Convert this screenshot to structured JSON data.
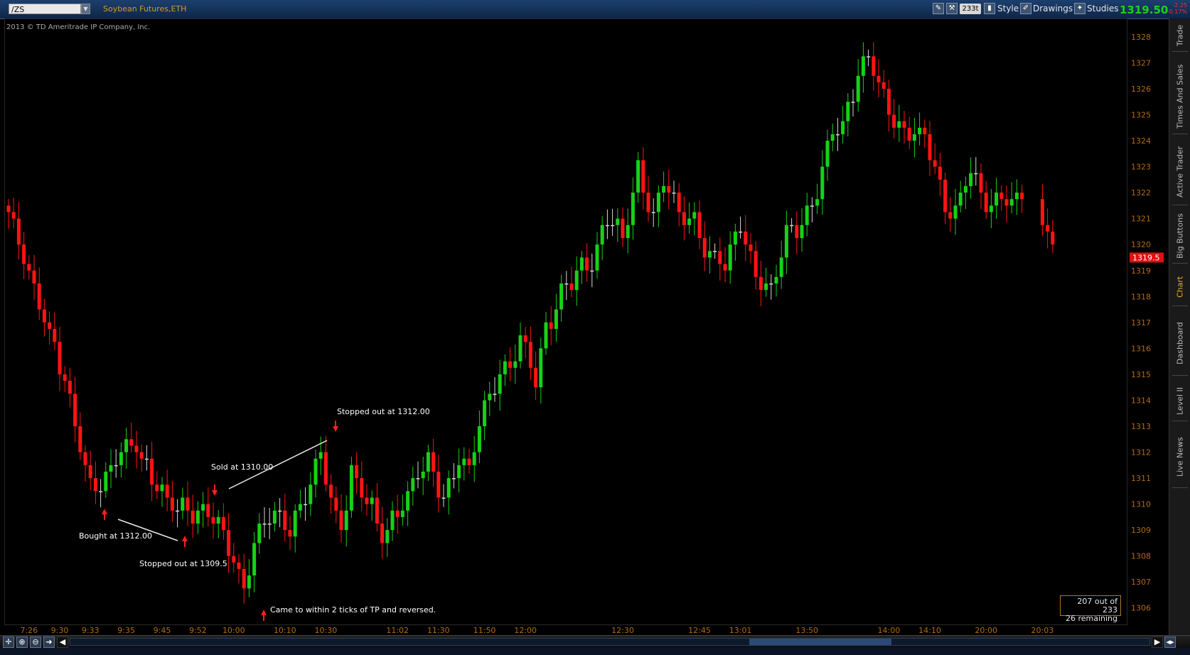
{
  "header": {
    "symbol": "/ZS",
    "title": "Soybean Futures,ETH",
    "ticks_badge": "233t",
    "style_label": "Style",
    "drawings_label": "Drawings",
    "studies_label": "Studies",
    "last_price": "1319.50",
    "change_abs": "-2.25",
    "change_pct": "-0.17%"
  },
  "copyright": "2013 © TD Ameritrade IP Company, Inc.",
  "current_price_label": "1319.5",
  "counter": {
    "line1": "207 out of 233",
    "line2": "26  remaining"
  },
  "side_tabs": [
    "Trade",
    "Times And Sales",
    "Active Trader",
    "Big Buttons",
    "Chart",
    "Dashboard",
    "Level II",
    "Live News"
  ],
  "colors": {
    "up": "#17d117",
    "down": "#ff1414",
    "neutral": "#d8d8d8",
    "axis_text": "#b26a14",
    "annotation": "#ffffff",
    "arrow": "#ff2020"
  },
  "chart_data": {
    "type": "candlestick",
    "ylim": [
      1305.5,
      1328.6
    ],
    "y_ticks": [
      1306,
      1307,
      1308,
      1309,
      1310,
      1311,
      1312,
      1313,
      1314,
      1315,
      1316,
      1317,
      1318,
      1319,
      1320,
      1321,
      1322,
      1323,
      1324,
      1325,
      1326,
      1327,
      1328
    ],
    "x_tick_labels": [
      {
        "i": 4,
        "label": "7:26"
      },
      {
        "i": 10,
        "label": "9:30"
      },
      {
        "i": 16,
        "label": "9:33"
      },
      {
        "i": 23,
        "label": "9:35"
      },
      {
        "i": 30,
        "label": "9:45"
      },
      {
        "i": 37,
        "label": "9:52"
      },
      {
        "i": 44,
        "label": "10:00"
      },
      {
        "i": 54,
        "label": "10:10"
      },
      {
        "i": 62,
        "label": "10:30"
      },
      {
        "i": 76,
        "label": "11:02"
      },
      {
        "i": 84,
        "label": "11:30"
      },
      {
        "i": 93,
        "label": "11:50"
      },
      {
        "i": 101,
        "label": "12:00"
      },
      {
        "i": 120,
        "label": "12:30"
      },
      {
        "i": 135,
        "label": "12:45"
      },
      {
        "i": 143,
        "label": "13:01"
      },
      {
        "i": 156,
        "label": "13:50"
      },
      {
        "i": 172,
        "label": "14:00"
      },
      {
        "i": 180,
        "label": "14:10"
      },
      {
        "i": 191,
        "label": "20:00"
      },
      {
        "i": 199,
        "label": "20:03"
      }
    ],
    "anchors": [
      [
        0,
        1321
      ],
      [
        6,
        1318
      ],
      [
        11,
        1314.5
      ],
      [
        16,
        1311
      ],
      [
        19,
        1310.8
      ],
      [
        22,
        1312
      ],
      [
        25,
        1312.5
      ],
      [
        28,
        1311
      ],
      [
        31,
        1309.8
      ],
      [
        35,
        1310
      ],
      [
        38,
        1309.8
      ],
      [
        41,
        1309
      ],
      [
        44,
        1308
      ],
      [
        46,
        1307
      ],
      [
        48,
        1308.5
      ],
      [
        51,
        1309.3
      ],
      [
        55,
        1309.3
      ],
      [
        58,
        1310.3
      ],
      [
        61,
        1311.8
      ],
      [
        63,
        1310
      ],
      [
        65,
        1309.3
      ],
      [
        67,
        1311.3
      ],
      [
        70,
        1310
      ],
      [
        73,
        1308.7
      ],
      [
        76,
        1310
      ],
      [
        79,
        1310.6
      ],
      [
        82,
        1311.6
      ],
      [
        85,
        1310.4
      ],
      [
        88,
        1311.8
      ],
      [
        90,
        1311
      ],
      [
        92,
        1313
      ],
      [
        94,
        1314.3
      ],
      [
        96,
        1315.2
      ],
      [
        98,
        1315.4
      ],
      [
        100,
        1316.2
      ],
      [
        103,
        1314.8
      ],
      [
        105,
        1317
      ],
      [
        108,
        1318.2
      ],
      [
        111,
        1318.6
      ],
      [
        114,
        1319.5
      ],
      [
        117,
        1321.3
      ],
      [
        120,
        1320
      ],
      [
        123,
        1322.8
      ],
      [
        126,
        1321.3
      ],
      [
        128,
        1322.5
      ],
      [
        131,
        1321
      ],
      [
        134,
        1321
      ],
      [
        137,
        1319.7
      ],
      [
        140,
        1319
      ],
      [
        143,
        1320.8
      ],
      [
        146,
        1319
      ],
      [
        149,
        1318
      ],
      [
        152,
        1320.3
      ],
      [
        155,
        1321
      ],
      [
        158,
        1322
      ],
      [
        161,
        1324.2
      ],
      [
        163,
        1324.6
      ],
      [
        166,
        1326.8
      ],
      [
        168,
        1327.2
      ],
      [
        170,
        1326
      ],
      [
        172,
        1325
      ],
      [
        175,
        1324.5
      ],
      [
        177,
        1324.6
      ],
      [
        179,
        1324
      ],
      [
        181,
        1322.8
      ],
      [
        183,
        1321.2
      ],
      [
        186,
        1322
      ],
      [
        188,
        1323
      ],
      [
        190,
        1321.5
      ],
      [
        192,
        1321.4
      ],
      [
        194,
        1322
      ],
      [
        196,
        1322
      ],
      [
        198,
        1321.8
      ],
      [
        200,
        1320
      ],
      [
        201,
        1319.5
      ]
    ],
    "gap_after_index": 198,
    "candle_count": 202,
    "annotations": [
      {
        "text": "Bought at 1312.00"
      },
      {
        "text": "Stopped out at 1309.5"
      },
      {
        "text": "Sold at 1310.00"
      },
      {
        "text": "Stopped out at 1312.00"
      },
      {
        "text": "Came to within 2 ticks of TP and reversed."
      }
    ]
  }
}
